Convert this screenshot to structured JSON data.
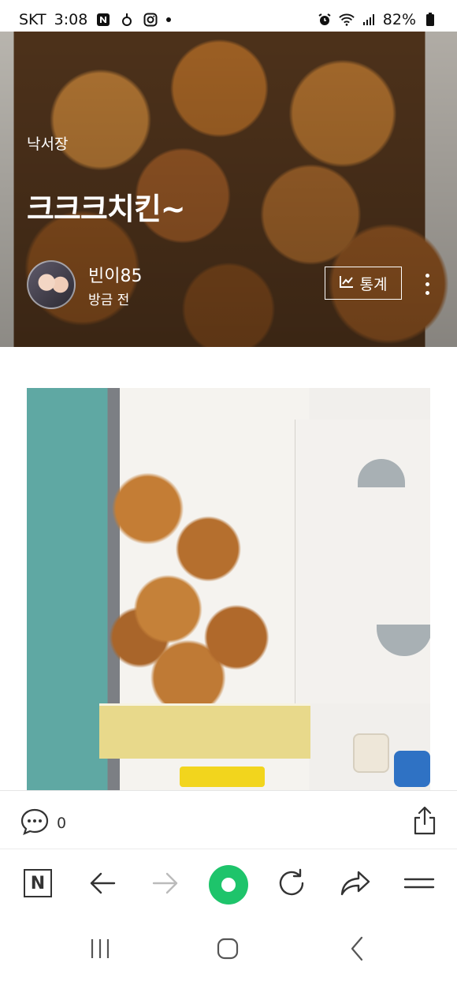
{
  "status_bar": {
    "carrier": "SKT",
    "time": "3:08",
    "battery": "82%",
    "left_icons": [
      "naver-n-icon",
      "notification-icon",
      "instagram-icon",
      "dot-icon"
    ],
    "right_icons": [
      "alarm-icon",
      "wifi-icon",
      "signal-icon",
      "battery-icon"
    ]
  },
  "post": {
    "category": "낙서장",
    "title": "크크크치킨~",
    "author": "빈이85",
    "time_ago": "방금 전",
    "stats_label": "통계",
    "comment_count": "0"
  },
  "toolbar": {
    "items": [
      "naver-n-icon",
      "back-arrow-icon",
      "forward-arrow-icon",
      "green-home-icon",
      "refresh-icon",
      "share-arrow-icon",
      "menu-icon"
    ]
  },
  "system_nav": {
    "items": [
      "recent-apps-icon",
      "home-icon",
      "back-icon"
    ]
  },
  "colors": {
    "accent_green": "#1ec46b",
    "text": "#222222",
    "icon": "#333333"
  }
}
